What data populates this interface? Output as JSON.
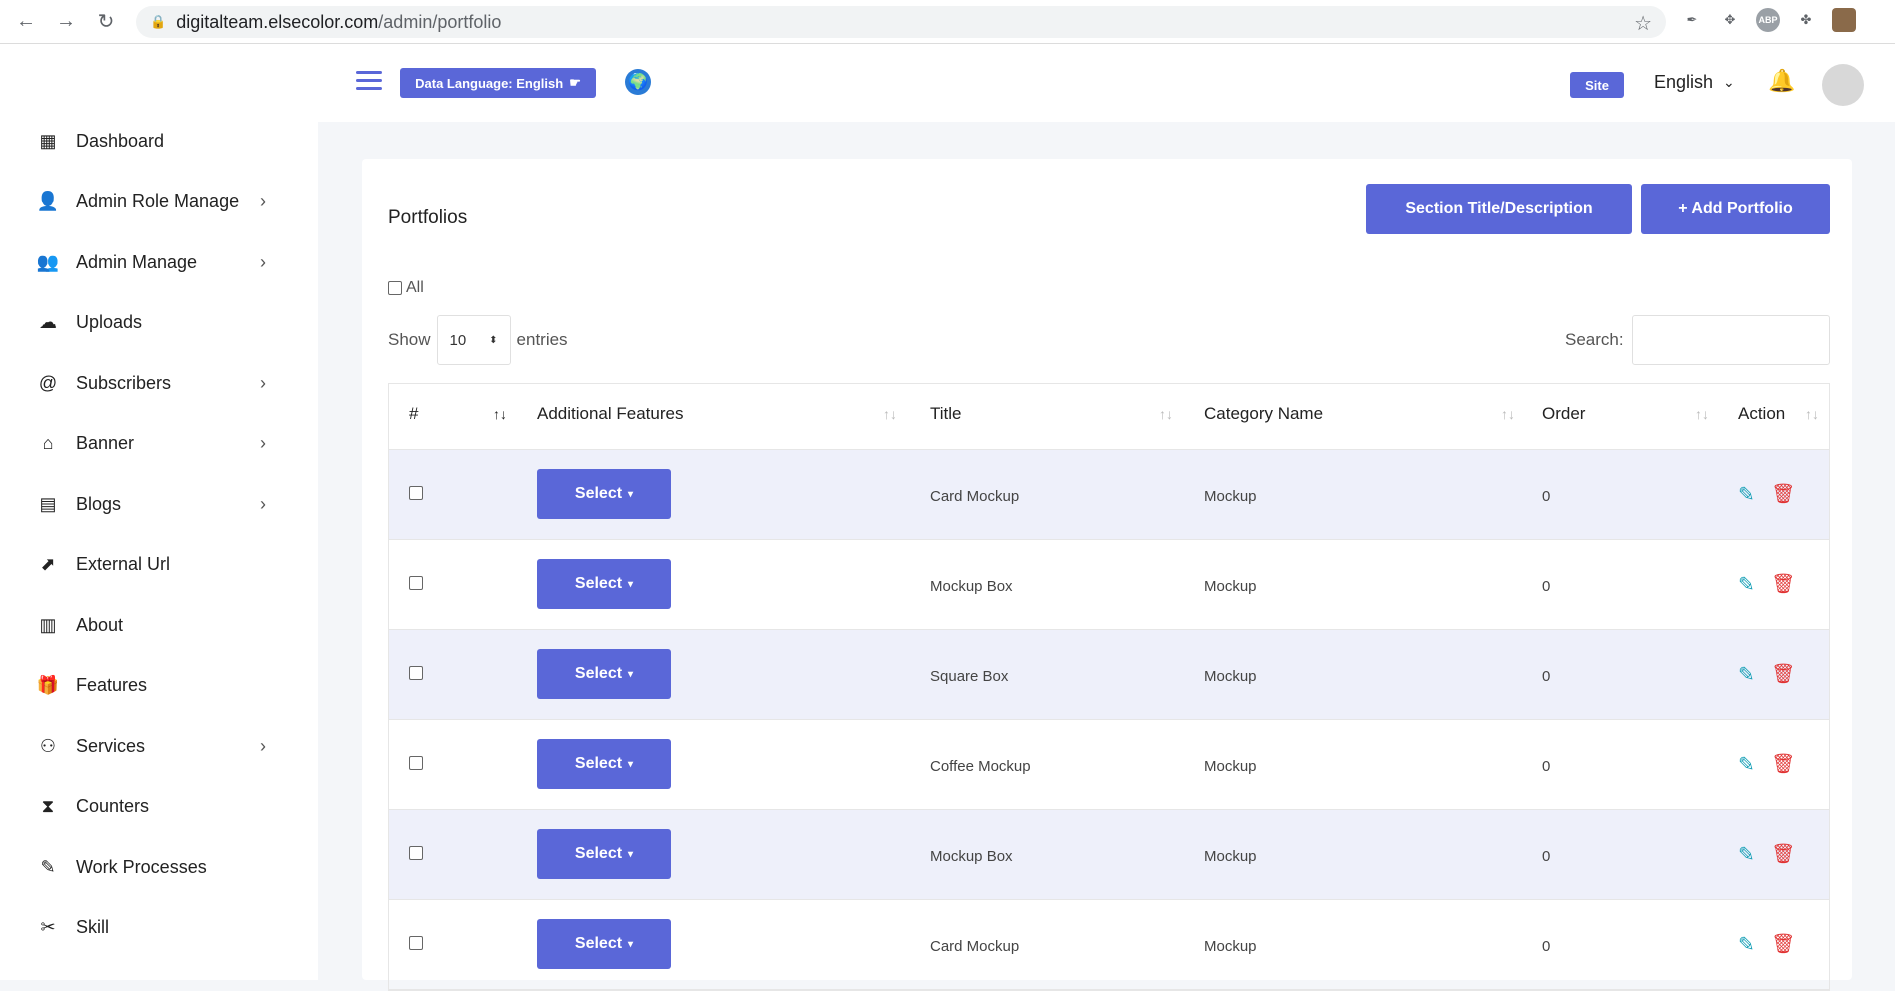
{
  "browser": {
    "url_host": "digitalteam.elsecolor.com",
    "url_path": "/admin/portfolio",
    "nav": {
      "back": "←",
      "forward": "→",
      "reload": "↻",
      "lock": "🔒",
      "star": "☆"
    },
    "extensions": {
      "abp": "ABP"
    }
  },
  "header": {
    "data_language": "Data Language: English",
    "site": "Site",
    "language": "English",
    "language_caret": "⌄",
    "bell": "🔔",
    "globe": "🌍",
    "pointer": "☛"
  },
  "sidebar": {
    "items": [
      {
        "label": "Dashboard",
        "icon": "▦",
        "chevron": false
      },
      {
        "label": "Admin Role Manage",
        "icon": "👤",
        "chevron": true
      },
      {
        "label": "Admin Manage",
        "icon": "👥",
        "chevron": true
      },
      {
        "label": "Uploads",
        "icon": "☁",
        "chevron": false
      },
      {
        "label": "Subscribers",
        "icon": "@",
        "chevron": true
      },
      {
        "label": "Banner",
        "icon": "⌂",
        "chevron": true
      },
      {
        "label": "Blogs",
        "icon": "▤",
        "chevron": true
      },
      {
        "label": "External Url",
        "icon": "⬈",
        "chevron": false
      },
      {
        "label": "About",
        "icon": "▥",
        "chevron": false
      },
      {
        "label": "Features",
        "icon": "🎁",
        "chevron": false
      },
      {
        "label": "Services",
        "icon": "⚇",
        "chevron": true
      },
      {
        "label": "Counters",
        "icon": "⧗",
        "chevron": false
      },
      {
        "label": "Work Processes",
        "icon": "✎",
        "chevron": false
      },
      {
        "label": "Skill",
        "icon": "✂",
        "chevron": false
      }
    ],
    "chevron": "›"
  },
  "main": {
    "title": "Portfolios",
    "section_button": "Section Title/Description",
    "add_button": "+ Add Portfolio",
    "all_label": "All",
    "show_label": "Show",
    "entries_value": "10",
    "entries_label": "entries",
    "search_label": "Search:",
    "columns": [
      "#",
      "Additional Features",
      "Title",
      "Category Name",
      "Order",
      "Action"
    ],
    "sort_glyph": "↑↓",
    "select_label": "Select",
    "caret": "▾",
    "edit_icon": "✎",
    "delete_icon": "🗑",
    "rows": [
      {
        "title": "Card Mockup",
        "category": "Mockup",
        "order": "0"
      },
      {
        "title": "Mockup Box",
        "category": "Mockup",
        "order": "0"
      },
      {
        "title": "Square Box",
        "category": "Mockup",
        "order": "0"
      },
      {
        "title": "Coffee Mockup",
        "category": "Mockup",
        "order": "0"
      },
      {
        "title": "Mockup Box",
        "category": "Mockup",
        "order": "0"
      },
      {
        "title": "Card Mockup",
        "category": "Mockup",
        "order": "0"
      }
    ]
  },
  "colors": {
    "accent": "#5a67d8",
    "edit": "#1ba2b8",
    "delete": "#e03131",
    "row_alt": "#eef0fa"
  }
}
